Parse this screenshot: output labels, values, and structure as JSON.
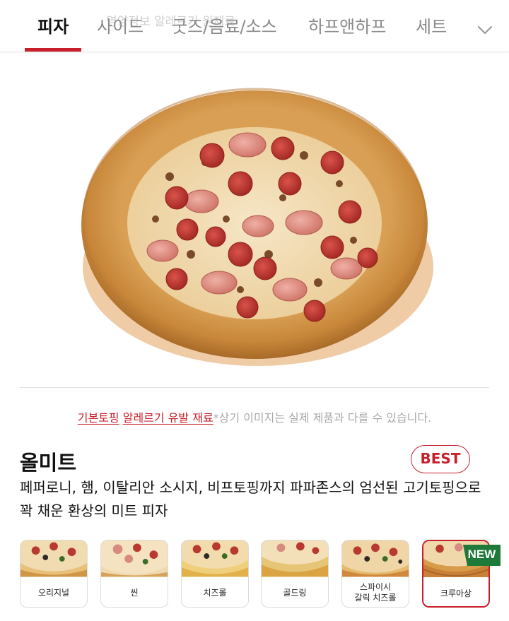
{
  "tabs": [
    {
      "label": "피자",
      "active": true
    },
    {
      "label": "사이드",
      "active": false
    },
    {
      "label": "굿즈/음료/소스",
      "active": false
    },
    {
      "label": "하프앤하프",
      "active": false
    },
    {
      "label": "세트",
      "active": false
    }
  ],
  "ghost_tabs": "영양정보    알레르기    원재료",
  "icons": {
    "more": "chevron-down-icon",
    "new": "new-tag-icon"
  },
  "notice": {
    "link_basic": "기본토핑",
    "link_allergy": "알레르기 유발 재료",
    "text": "*상기 이미지는 실제 제품과 다를 수 있습니다."
  },
  "product": {
    "name": "올미트",
    "badge": "BEST",
    "description": "페퍼로니, 햄, 이탈리안 소시지, 비프토핑까지 파파존스의 엄선된 고기토핑으로 꽉 채운 환상의 미트 피자"
  },
  "dough_options": [
    {
      "label": "오리지널",
      "selected": false
    },
    {
      "label": "씬",
      "selected": false
    },
    {
      "label": "치즈롤",
      "selected": false
    },
    {
      "label": "골드링",
      "selected": false
    },
    {
      "label": "스파이시\n갈릭 치즈롤",
      "selected": false
    },
    {
      "label": "크루아상",
      "selected": true,
      "tag": "NEW"
    }
  ],
  "colors": {
    "accent": "#c8202a",
    "new_tag": "#1f7a3a",
    "crust": "#c98a3c"
  }
}
